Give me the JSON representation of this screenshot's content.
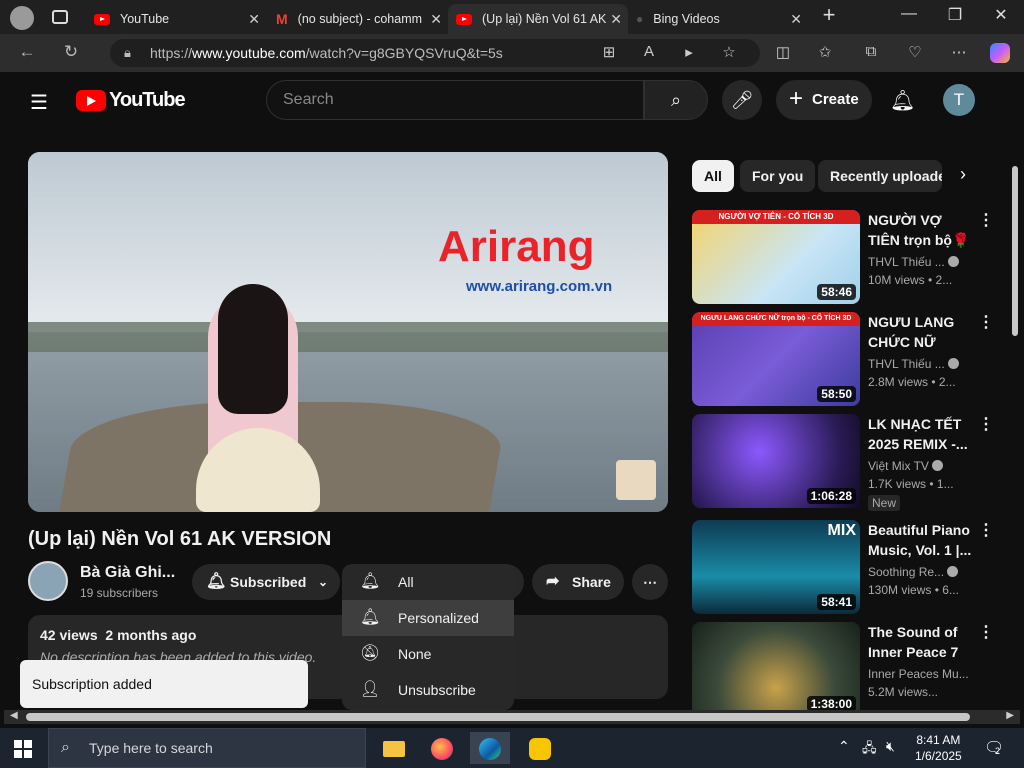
{
  "browser": {
    "tabs": [
      {
        "label": "YouTube",
        "type": "youtube"
      },
      {
        "label": "(no subject) - cohamm",
        "type": "gmail"
      },
      {
        "label": "(Up lại) Nền Vol 61 AK",
        "type": "youtube"
      },
      {
        "label": "Bing Videos",
        "type": "bing"
      }
    ],
    "url_prefix": "https://",
    "url_host": "www.youtube.com",
    "url_path": "/watch?v=g8GBYQSVruQ&t=5s"
  },
  "youtube": {
    "logo": "YouTube",
    "search_placeholder": "Search",
    "create_label": "Create",
    "avatar_letter": "T"
  },
  "player": {
    "brand": "Arirang",
    "brand_url": "www.arirang.com.vn"
  },
  "video": {
    "title": "(Up lại) Nền Vol 61 AK VERSION",
    "channel": "Bà Già Ghi...",
    "subscribers": "19 subscribers",
    "subscribed_label": "Subscribed",
    "share_label": "Share",
    "views": "42 views",
    "age": "2 months ago",
    "description": "No description has been added to this video."
  },
  "notification_menu": {
    "items": [
      "All",
      "Personalized",
      "None",
      "Unsubscribe"
    ],
    "highlighted": "Personalized"
  },
  "toast": {
    "text": "Subscription added"
  },
  "chips": [
    "All",
    "For you",
    "Recently uploade"
  ],
  "recommendations": [
    {
      "title": "NGƯỜI VỢ TIÊN trọn bộ🌹🌷 C...",
      "channel": "THVL Thiếu ...",
      "stats": "10M views • 2...",
      "duration": "58:46",
      "thumb_caption": "NGƯỜI VỢ TIÊN - CỔ TÍCH 3D",
      "new": ""
    },
    {
      "title": "NGƯU LANG CHỨC NỮ Trọ...",
      "channel": "THVL Thiếu ...",
      "stats": "2.8M views • 2...",
      "duration": "58:50",
      "thumb_caption": "NGƯU LANG CHỨC NỮ trọn bộ - CỔ TÍCH 3D",
      "new": ""
    },
    {
      "title": "LK NHẠC TẾT 2025 REMIX -...",
      "channel": "Việt Mix TV",
      "stats": "1.7K views • 1...",
      "duration": "1:06:28",
      "thumb_caption": "",
      "new": "New"
    },
    {
      "title": "Beautiful Piano Music, Vol. 1 |...",
      "channel": "Soothing Re...",
      "stats": "130M views • 6...",
      "duration": "58:41",
      "thumb_caption": "MIX",
      "new": ""
    },
    {
      "title": "The Sound of Inner Peace 7 ...",
      "channel": "Inner Peaces Mu...",
      "stats": "5.2M views...",
      "duration": "1:38:00",
      "thumb_caption": "",
      "new": ""
    }
  ],
  "taskbar": {
    "search_placeholder": "Type here to search",
    "time": "8:41 AM",
    "date": "1/6/2025",
    "notification_count": "2"
  }
}
